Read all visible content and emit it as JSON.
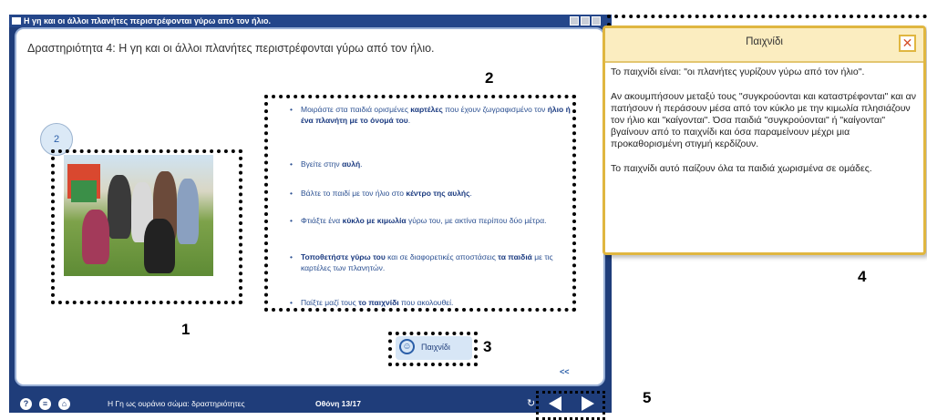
{
  "window": {
    "title": "Η γη και οι άλλοι πλανήτες περιστρέφονται γύρω από τον ήλιο."
  },
  "activity": {
    "heading": "Δραστηριότητα 4: Η γη και οι άλλοι πλανήτες περιστρέφονται γύρω από τον ήλιο.",
    "step": "2"
  },
  "instructions": [
    {
      "html": "Μοιράστε στα παιδιά ορισμένες <b>καρτέλες</b> που έχουν ζωγραφισμένο τον <b>ήλιο ή ένα πλανήτη με το όνομά του</b>."
    },
    {
      "html": "Βγείτε στην <b>αυλή</b>."
    },
    {
      "html": "Βάλτε το παιδί με τον ήλιο στο <b>κέντρο της αυλής</b>."
    },
    {
      "html": "Φτιάξτε ένα <b>κύκλο με κιμωλία</b> γύρω του, με ακτίνα περίπου δύο μέτρα."
    },
    {
      "html": "<b>Τοποθετήστε γύρω του</b> και σε διαφορετικές αποστάσεις <b>τα παιδιά</b> με τις καρτέλες των πλανητών."
    },
    {
      "html": "Παίξτε μαζί τους <b>το παιχνίδι</b> που ακολουθεί."
    }
  ],
  "game_button": {
    "label": "Παιχνίδι"
  },
  "back_label": "<<",
  "bottom_bar": {
    "section": "Η Γη ως ουράνιο σώμα: δραστηριότητες",
    "screen": "Οθόνη 13/17"
  },
  "popup": {
    "title": "Παιχνίδι",
    "paragraphs": [
      "Το παιχνίδι είναι: \"οι πλανήτες γυρίζουν γύρω από τον ήλιο\".",
      "Αν ακουμπήσουν μεταξύ τους \"συγκρούονται και καταστρέφονται\" και αν πατήσουν ή περάσουν μέσα από τον κύκλο με την κιμωλία πλησιάζουν τον ήλιο και \"καίγονται\". Όσα παιδιά \"συγκρούονται\" ή \"καίγονται\" βγαίνουν από το παιχνίδι και όσα παραμείνουν μέχρι μια προκαθορισμένη στιγμή κερδίζουν.",
      "Το παιχνίδι αυτό παίζουν όλα τα παιδιά χωρισμένα σε ομάδες."
    ]
  },
  "callouts": [
    "1",
    "2",
    "3",
    "4",
    "5"
  ],
  "icons": {
    "help": "?",
    "menu": "≡",
    "home": "⌂",
    "refresh": "↻",
    "smile": "☺",
    "close": "✕"
  },
  "colors": {
    "frame": "#1f3d7a",
    "accent": "#e0b640",
    "text_blue": "#2a4f91"
  }
}
